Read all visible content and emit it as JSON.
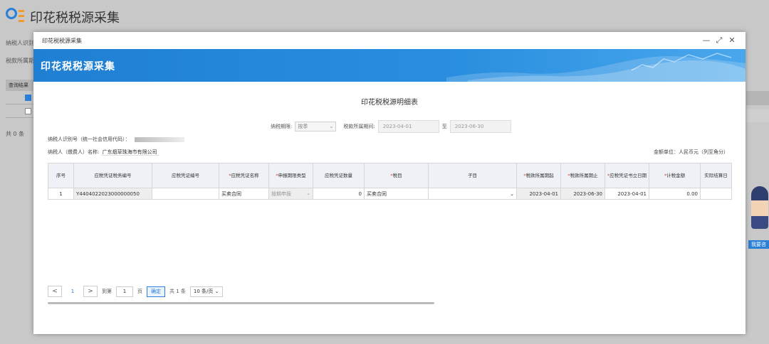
{
  "background": {
    "title": "印花税税源采集",
    "label1": "纳税人识别",
    "label2": "税款所属期",
    "table_head": "查询结果",
    "total": "共 0 条",
    "mascot_label": "我要咨"
  },
  "modal": {
    "title": "印花税税源采集",
    "banner_title": "印花税税源采集",
    "controls": {
      "minimize": "—",
      "maximize": "⤢",
      "close": "✕"
    },
    "page_heading": "印花税税源明细表",
    "filter": {
      "period_label": "纳税期限:",
      "period_value": "按季",
      "range_label": "税款所属期间:",
      "start": "2023-04-01",
      "to": "至",
      "end": "2023-06-30"
    },
    "taxid_label": "纳税人识别号（统一社会信用代码）：",
    "taxpayer_label": "纳税人（缴费人）名称:",
    "taxpayer_name": "广东烟草珠海市有限公司",
    "unit": "金额单位：人民币元（列至角分）",
    "table": {
      "headers": [
        {
          "text": "序号",
          "req": false
        },
        {
          "text": "应税凭证税务编号",
          "req": false
        },
        {
          "text": "应税凭证编号",
          "req": false
        },
        {
          "text": "应税凭证名称",
          "req": true
        },
        {
          "text": "申报期限类型",
          "req": true
        },
        {
          "text": "应税凭证数量",
          "req": false
        },
        {
          "text": "税目",
          "req": true
        },
        {
          "text": "子目",
          "req": false
        },
        {
          "text": "税款所属期起",
          "req": true
        },
        {
          "text": "税款所属期止",
          "req": true
        },
        {
          "text": "应税凭证书立日期",
          "req": true
        },
        {
          "text": "计税金额",
          "req": true
        },
        {
          "text": "实际结算日",
          "req": false
        }
      ],
      "row": {
        "seq": "1",
        "code": "Y4404022023000000050",
        "voucher_no": "",
        "voucher_name": "买卖合同",
        "period_type": "按期申报",
        "quantity": "0",
        "item": "买卖合同",
        "subitem": "",
        "start": "2023-04-01",
        "end": "2023-06-30",
        "sign_date": "2023-04-01",
        "amount": "0.00",
        "settle": ""
      }
    },
    "pager": {
      "prev": "<",
      "current": "1",
      "next": ">",
      "goto": "到第",
      "page_input": "1",
      "page_unit": "页",
      "confirm": "确定",
      "total": "共 1 条",
      "page_size": "10 条/页"
    }
  }
}
